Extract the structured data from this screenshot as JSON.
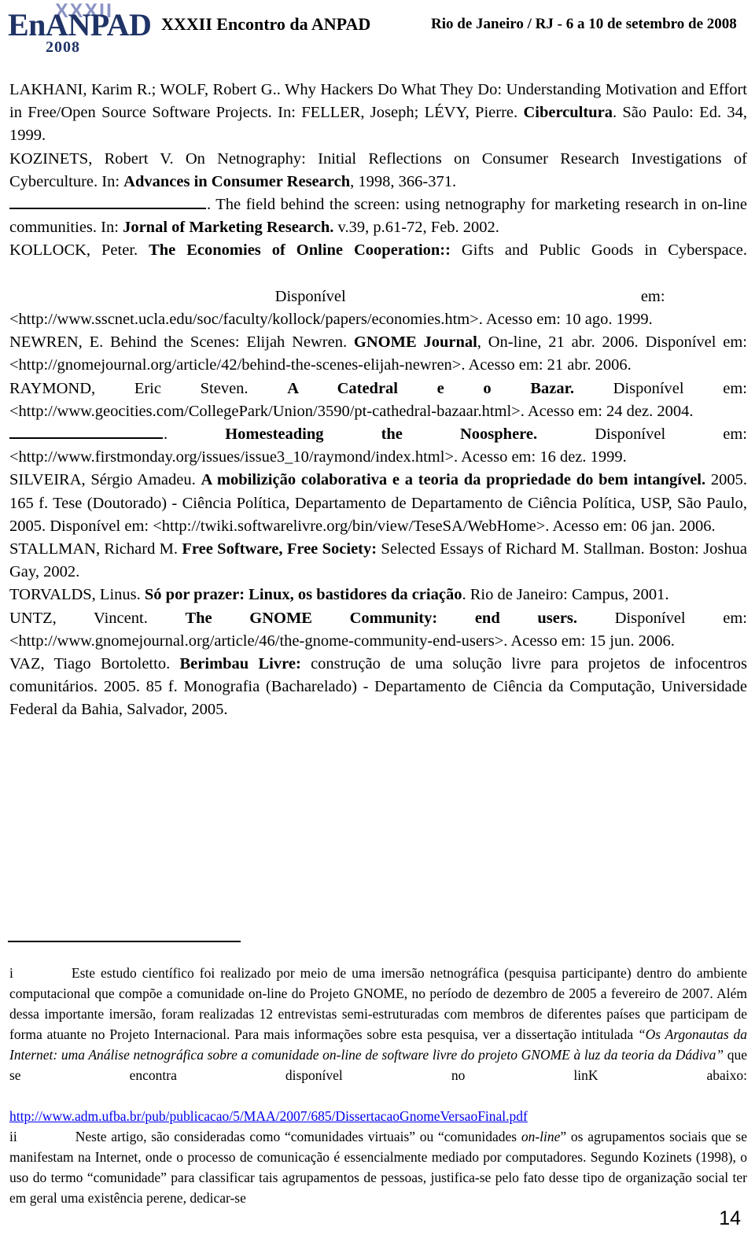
{
  "header": {
    "logo": {
      "roman": "XXXII",
      "name": "EnANPAD",
      "year": "2008",
      "color_accent": "#8b93c4",
      "color_main": "#1f3366"
    },
    "title": "XXXII Encontro da ANPAD",
    "date": "Rio de Janeiro / RJ - 6 a 10 de setembro de 2008"
  },
  "references": [
    {
      "id": "lakhani-wolf",
      "parts": [
        {
          "t": "LAKHANI, Karim R.; WOLF, Robert G.. Why Hackers Do What They Do: Understanding Motivation and Effort in Free/Open Source Software Projects. In: FELLER, Joseph; LÉVY, Pierre. ",
          "b": false
        },
        {
          "t": "Cibercultura",
          "b": true
        },
        {
          "t": ". São Paulo: Ed. 34, 1999.",
          "b": false
        }
      ]
    },
    {
      "id": "kozinets-1998",
      "parts": [
        {
          "t": "KOZINETS, Robert V. On Netnography: Initial Reflections on Consumer Research Investigations of Cyberculture. In: ",
          "b": false
        },
        {
          "t": "Advances in Consumer Research",
          "b": true
        },
        {
          "t": ", 1998, 366-371.",
          "b": false
        }
      ]
    },
    {
      "id": "kozinets-2002",
      "dash": true,
      "parts": [
        {
          "t": ". The field behind the screen: using netnography for marketing research in on-line communities. In: ",
          "b": false
        },
        {
          "t": "Jornal of Marketing Research.",
          "b": true
        },
        {
          "t": " v.39, p.61-72, Feb. 2002.",
          "b": false
        }
      ]
    },
    {
      "id": "kollock",
      "parts": [
        {
          "t": "KOLLOCK, Peter. ",
          "b": false
        },
        {
          "t": "The Economies of Online Cooperation::",
          "b": true
        },
        {
          "t": " Gifts and Public Goods in Cyberspace.",
          "b": false
        }
      ],
      "spaced_line": {
        "a": "Disponível",
        "b": "em:"
      },
      "tail": "<http://www.sscnet.ucla.edu/soc/faculty/kollock/papers/economies.htm>. Acesso em: 10 ago. 1999."
    },
    {
      "id": "newren",
      "parts": [
        {
          "t": "NEWREN, E. Behind the Scenes: Elijah Newren. ",
          "b": false
        },
        {
          "t": "GNOME Journal",
          "b": true
        },
        {
          "t": ", On-line, 21 abr. 2006. Disponível em: <http://gnomejournal.org/article/42/behind-the-scenes-elijah-newren>. Acesso em: 21 abr. 2006.",
          "b": false
        }
      ]
    },
    {
      "id": "raymond-catedral",
      "parts": [
        {
          "t": "RAYMOND, Eric Steven. ",
          "b": false
        },
        {
          "t": "A Catedral e o Bazar.",
          "b": true
        },
        {
          "t": " Disponível em: <http://www.geocities.com/CollegePark/Union/3590/pt-cathedral-bazaar.html>. Acesso em: 24 dez. 2004.",
          "b": false
        }
      ]
    },
    {
      "id": "raymond-homesteading",
      "dash": true,
      "parts": [
        {
          "t": ". ",
          "b": false
        },
        {
          "t": "Homesteading the Noosphere.",
          "b": true
        },
        {
          "t": " Disponível em: <http://www.firstmonday.org/issues/issue3_10/raymond/index.html>. Acesso em: 16 dez. 1999.",
          "b": false
        }
      ]
    },
    {
      "id": "silveira",
      "parts": [
        {
          "t": "SILVEIRA, Sérgio Amadeu. ",
          "b": false
        },
        {
          "t": "A mobilizição colaborativa e a teoria da propriedade do bem intangível.",
          "b": true
        },
        {
          "t": " 2005. 165 f. Tese (Doutorado) - Ciência Política, Departamento de Departamento de Ciência Política, USP, São Paulo, 2005. Disponível em: <http://twiki.softwarelivre.org/bin/view/TeseSA/WebHome>. Acesso em: 06 jan. 2006.",
          "b": false
        }
      ]
    },
    {
      "id": "stallman",
      "parts": [
        {
          "t": "STALLMAN, Richard M. ",
          "b": false
        },
        {
          "t": "Free Software, Free Society:",
          "b": true
        },
        {
          "t": " Selected Essays of Richard M. Stallman. Boston: Joshua Gay, 2002.",
          "b": false
        }
      ]
    },
    {
      "id": "torvalds",
      "parts": [
        {
          "t": "TORVALDS, Linus. ",
          "b": false
        },
        {
          "t": "Só por prazer: Linux, os bastidores da criação",
          "b": true
        },
        {
          "t": ". Rio de Janeiro: Campus, 2001.",
          "b": false
        }
      ]
    },
    {
      "id": "untz",
      "parts": [
        {
          "t": "UNTZ, Vincent. ",
          "b": false
        },
        {
          "t": "The GNOME Community: end users.",
          "b": true
        },
        {
          "t": " Disponível em: <http://www.gnomejournal.org/article/46/the-gnome-community-end-users>. Acesso em: 15 jun. 2006.",
          "b": false
        }
      ]
    },
    {
      "id": "vaz",
      "parts": [
        {
          "t": "VAZ, Tiago Bortoletto. ",
          "b": false
        },
        {
          "t": "Berimbau Livre:",
          "b": true
        },
        {
          "t": " construção de uma solução livre para projetos de infocentros comunitários. 2005. 85 f. Monografia (Bacharelado) - Departamento de Ciência da Computação, Universidade Federal da Bahia, Salvador, 2005.",
          "b": false
        }
      ]
    }
  ],
  "footnotes": [
    {
      "marker": "i",
      "segments": [
        {
          "t": "Este estudo científico foi realizado por meio de uma imersão netnográfica (pesquisa participante) dentro do ambiente computacional que compõe a comunidade on-line do Projeto GNOME, no período de dezembro de 2005 a fevereiro de 2007. Além dessa importante imersão, foram realizadas 12 entrevistas semi-estruturadas com membros de diferentes países que participam de forma atuante no Projeto Internacional. Para mais informações sobre esta pesquisa, ver a dissertação intitulada ",
          "style": "normal"
        },
        {
          "t": "“Os Argonautas da Internet: uma Análise netnográfica sobre a comunidade on-line de software livre do projeto GNOME à luz da teoria da Dádiva”",
          "style": "italic"
        },
        {
          "t": " que se encontra disponível no linK abaixo:",
          "style": "normal"
        }
      ],
      "link": "http://www.adm.ufba.br/pub/publicacao/5/MAA/2007/685/DissertacaoGnomeVersaoFinal.pdf"
    },
    {
      "marker": "ii",
      "segments": [
        {
          "t": "Neste artigo, são consideradas como “comunidades virtuais” ou “comunidades ",
          "style": "normal"
        },
        {
          "t": "on-line",
          "style": "italic"
        },
        {
          "t": "” os agrupamentos sociais que se manifestam na Internet, onde o processo de comunicação é essencialmente mediado por computadores. Segundo Kozinets (1998), o uso do termo “comunidade” para classificar tais agrupamentos de pessoas, justifica-se pelo fato desse tipo de organização social ter em geral uma existência perene, dedicar-se",
          "style": "normal"
        }
      ]
    }
  ],
  "page_number": "14"
}
